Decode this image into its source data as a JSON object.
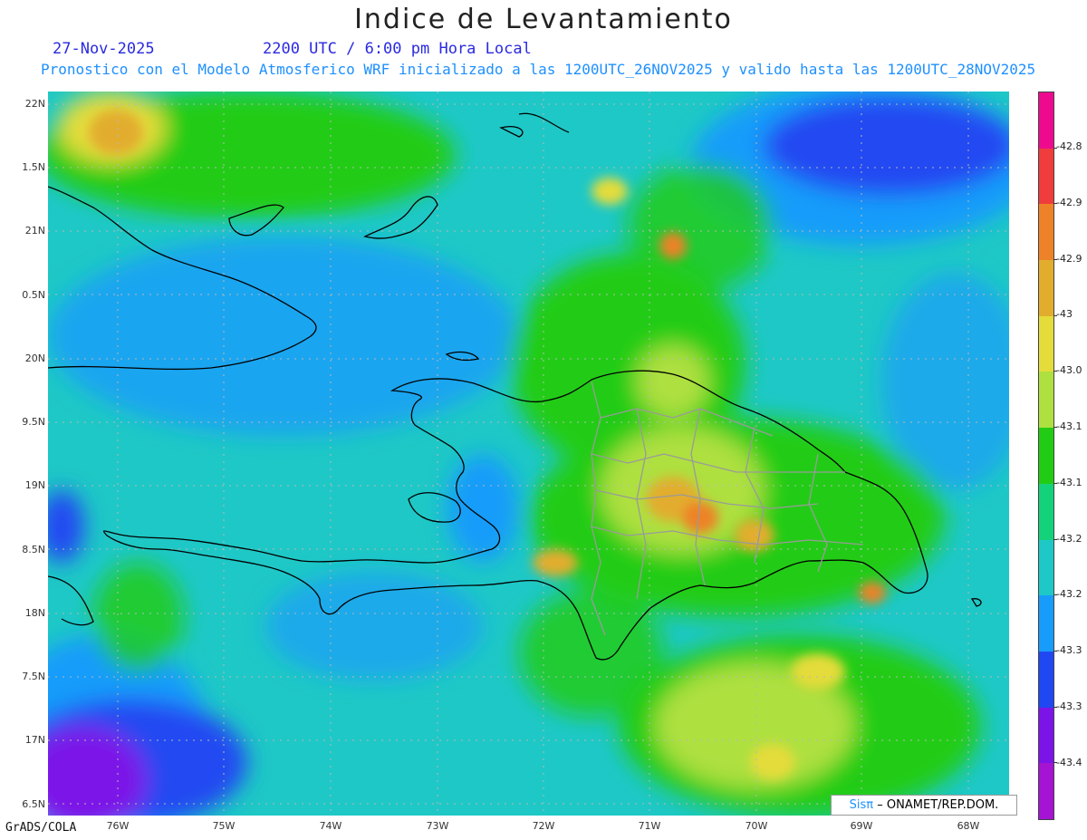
{
  "header": {
    "title": "Indice de Levantamiento",
    "date": "27-Nov-2025",
    "time": "2200 UTC / 6:00 pm Hora Local",
    "forecast_note": "Pronostico con el Modelo Atmosferico WRF inicializado a las 1200UTC_26NOV2025 y valido hasta las  1200UTC_28NOV2025",
    "date_color": "#2a2ae0",
    "forecast_color": "#1e90ff"
  },
  "axes": {
    "y_labels": [
      "22N",
      "1.5N",
      "21N",
      "0.5N",
      "20N",
      "9.5N",
      "19N",
      "8.5N",
      "18N",
      "7.5N",
      "17N",
      "6.5N"
    ],
    "x_labels": [
      "76W",
      "75W",
      "74W",
      "73W",
      "72W",
      "71W",
      "70W",
      "69W",
      "68W"
    ]
  },
  "colorbar": {
    "labels": [
      "-42.8",
      "-42.9",
      "-42.9",
      "-43",
      "-43.0",
      "-43.1",
      "-43.1",
      "-43.2",
      "-43.2",
      "-43.3",
      "-43.3",
      "-43.4"
    ],
    "colors": [
      "#ee0a8f",
      "#f03c3c",
      "#ee8228",
      "#e2ad2d",
      "#e4dc3a",
      "#aee03f",
      "#22cc14",
      "#14d27a",
      "#1ec8c6",
      "#189cfa",
      "#2048f2",
      "#7c14e8",
      "#a414d2"
    ]
  },
  "credit": {
    "brand": "Sisπ",
    "agency": " ONAMET/REP.DOM.",
    "separator": " –"
  },
  "footer": "GrADS/COLA"
}
